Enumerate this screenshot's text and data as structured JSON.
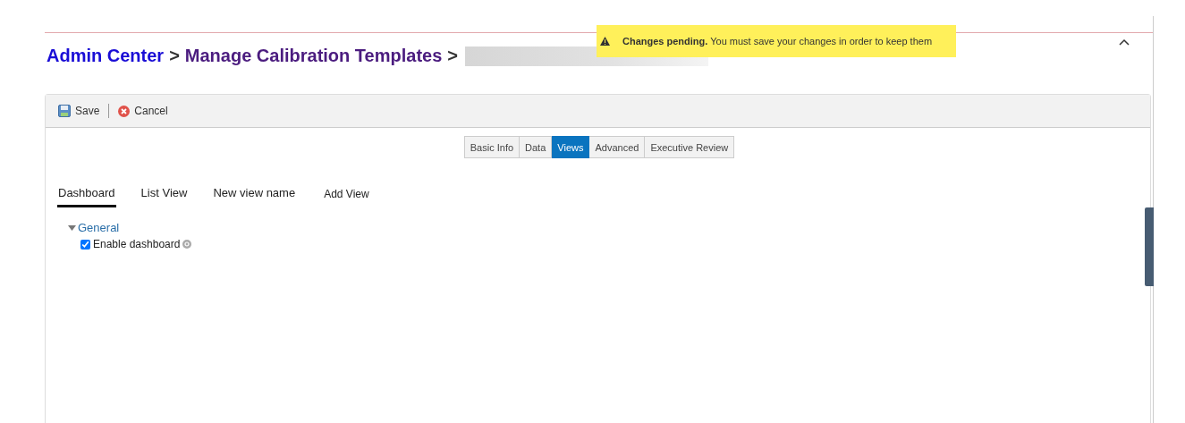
{
  "breadcrumb": [
    {
      "label": "Admin Center",
      "kind": "link"
    },
    {
      "label": "Manage Calibration Templates",
      "kind": "visited"
    }
  ],
  "breadcrumb_separator": ">",
  "banner": {
    "title": "Changes pending.",
    "message": "You must save your changes in order to keep them"
  },
  "toolbar": [
    {
      "label": "Save",
      "kind": "save"
    },
    {
      "label": "Cancel",
      "kind": "cancel"
    }
  ],
  "tabs": [
    {
      "label": "Basic Info",
      "selected": false
    },
    {
      "label": "Data",
      "selected": false
    },
    {
      "label": "Views",
      "selected": true
    },
    {
      "label": "Advanced",
      "selected": false
    },
    {
      "label": "Executive Review",
      "selected": false
    }
  ],
  "views": [
    {
      "label": "Dashboard",
      "selected": true
    },
    {
      "label": "List View",
      "selected": false
    },
    {
      "label": "New view name",
      "selected": false
    }
  ],
  "add_view": "Add View",
  "section": {
    "title": "General",
    "expanded": true,
    "options": [
      {
        "label": "Enable dashboard",
        "checked": true
      }
    ]
  }
}
